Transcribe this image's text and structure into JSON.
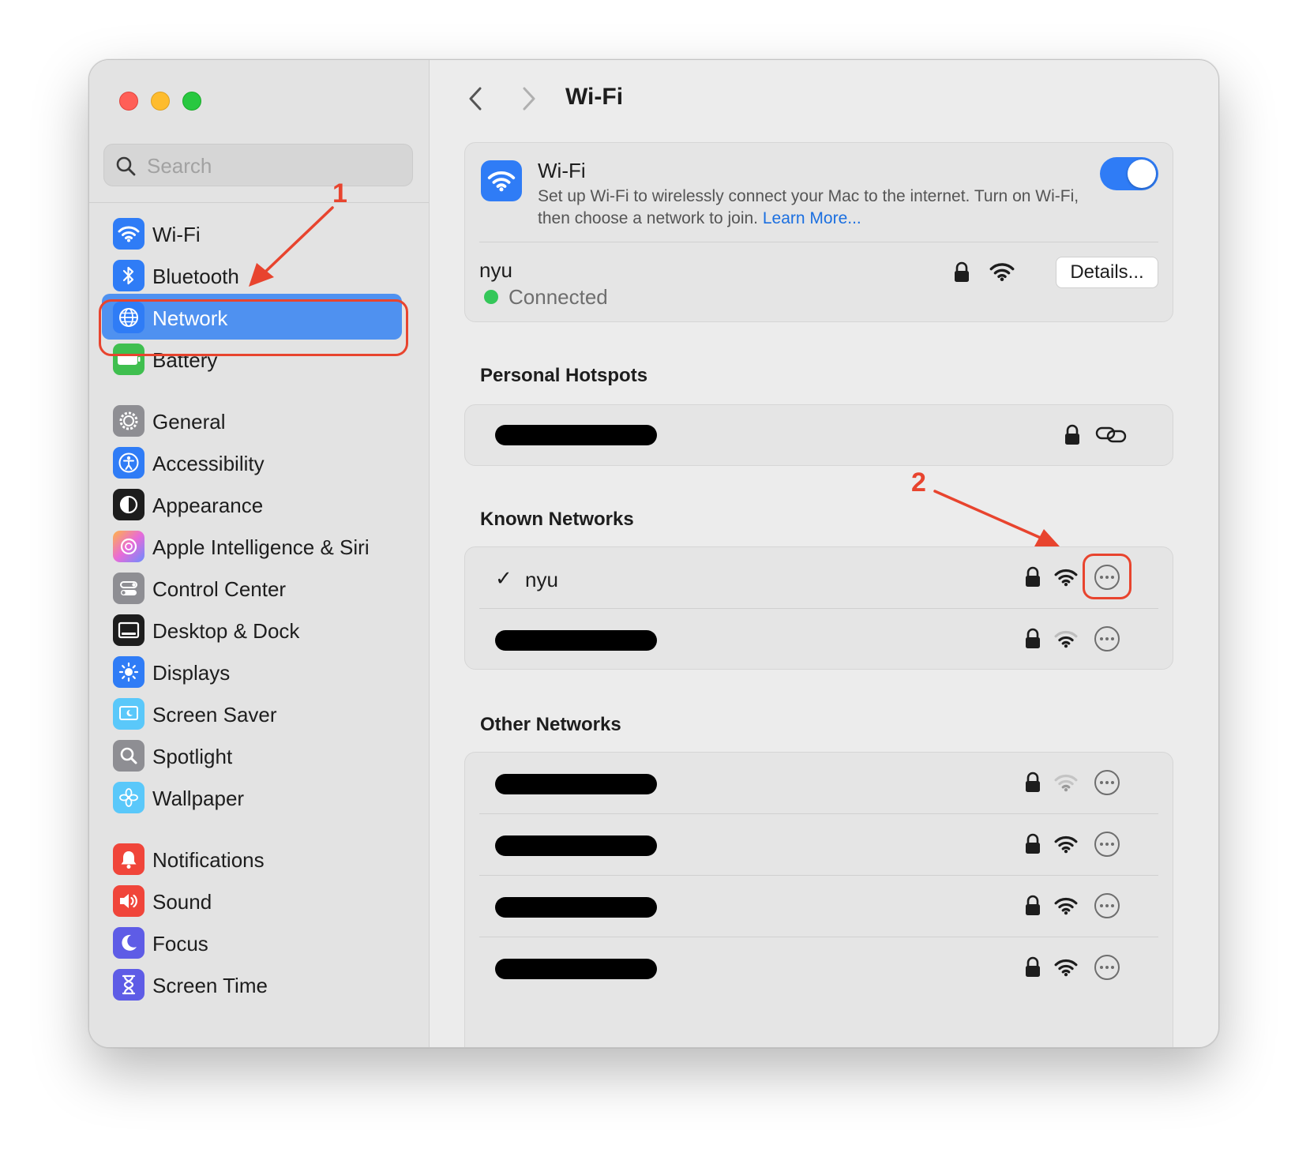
{
  "window": {
    "controls": [
      "close",
      "minimize",
      "zoom"
    ]
  },
  "sidebar": {
    "search_placeholder": "Search",
    "items": [
      {
        "label": "Wi-Fi",
        "icon": "wifi-icon",
        "color": "#2f7cf6"
      },
      {
        "label": "Bluetooth",
        "icon": "bluetooth-icon",
        "color": "#2f7cf6"
      },
      {
        "label": "Network",
        "icon": "globe-icon",
        "color": "#2f7cf6",
        "selected": true
      },
      {
        "label": "Battery",
        "icon": "battery-icon",
        "color": "#3fbf4f"
      },
      {
        "label": "General",
        "icon": "gear-icon",
        "color": "#8e8e93"
      },
      {
        "label": "Accessibility",
        "icon": "accessibility-icon",
        "color": "#2f7cf6"
      },
      {
        "label": "Appearance",
        "icon": "appearance-icon",
        "color": "#1d1d1d"
      },
      {
        "label": "Apple Intelligence & Siri",
        "icon": "siri-icon",
        "color": "#e86bd8"
      },
      {
        "label": "Control Center",
        "icon": "control-center-icon",
        "color": "#8e8e93"
      },
      {
        "label": "Desktop & Dock",
        "icon": "dock-icon",
        "color": "#1d1d1d"
      },
      {
        "label": "Displays",
        "icon": "sun-icon",
        "color": "#2f7cf6"
      },
      {
        "label": "Screen Saver",
        "icon": "screen-saver-icon",
        "color": "#5ac8fa"
      },
      {
        "label": "Spotlight",
        "icon": "spotlight-icon",
        "color": "#8e8e93"
      },
      {
        "label": "Wallpaper",
        "icon": "wallpaper-icon",
        "color": "#5ac8fa"
      },
      {
        "label": "Notifications",
        "icon": "bell-icon",
        "color": "#f0453a"
      },
      {
        "label": "Sound",
        "icon": "speaker-icon",
        "color": "#f0453a"
      },
      {
        "label": "Focus",
        "icon": "moon-icon",
        "color": "#5e5ce6"
      },
      {
        "label": "Screen Time",
        "icon": "hourglass-icon",
        "color": "#5e5ce6"
      }
    ]
  },
  "annotations": {
    "step1": "1",
    "step2": "2",
    "color": "#e8442e"
  },
  "main": {
    "title": "Wi-Fi",
    "wifi_card": {
      "title": "Wi-Fi",
      "description": "Set up Wi-Fi to wirelessly connect your Mac to the internet. Turn on Wi-Fi, then choose a network to join.",
      "learn_more": "Learn More...",
      "toggle_on": true,
      "current_network": "nyu",
      "status": "Connected",
      "details_button": "Details..."
    },
    "hotspots": {
      "title": "Personal Hotspots"
    },
    "known": {
      "title": "Known Networks",
      "items": [
        {
          "name": "nyu",
          "checked": true
        }
      ]
    },
    "other": {
      "title": "Other Networks"
    }
  }
}
